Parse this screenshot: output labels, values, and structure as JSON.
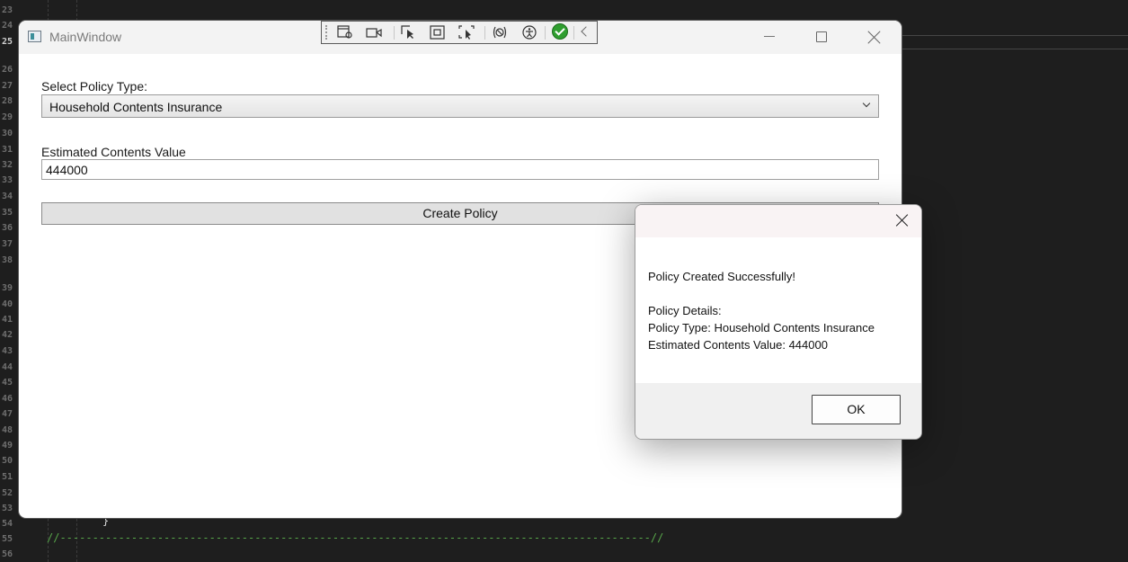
{
  "editor": {
    "line_numbers": [
      "23",
      "24",
      "25",
      "26",
      "27",
      "28",
      "29",
      "30",
      "31",
      "32",
      "33",
      "34",
      "35",
      "36",
      "37",
      "38",
      "39",
      "40",
      "41",
      "42",
      "43",
      "44",
      "45",
      "46",
      "47",
      "48",
      "49",
      "50",
      "51",
      "52",
      "53",
      "54",
      "55",
      "56"
    ],
    "active_line": "25",
    "code_brace": "}",
    "code_comment": "//-------------------------------------------------------------------------------------------//"
  },
  "main_window": {
    "title": "MainWindow",
    "policy_label": "Select Policy Type:",
    "policy_selected": "Household Contents Insurance",
    "value_label": "Estimated Contents Value",
    "value_input": "444000",
    "create_button": "Create Policy"
  },
  "debug_toolbar": {
    "icons": [
      "live-visual-tree-icon",
      "record-icon",
      "select-element-icon",
      "display-adorners-icon",
      "track-focus-icon",
      "binding-failures-icon",
      "accessibility-icon",
      "hot-reload-check-icon",
      "collapse-icon"
    ]
  },
  "dialog": {
    "message_line1": "Policy Created Successfully!",
    "details_header": "Policy Details:",
    "details_type": "Policy Type: Household Contents Insurance",
    "details_value": "Estimated Contents Value: 444000",
    "ok_label": "OK"
  }
}
